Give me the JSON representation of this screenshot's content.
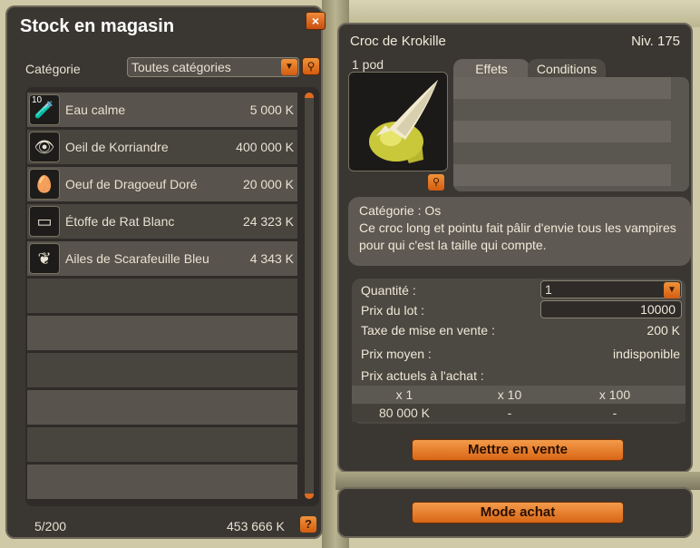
{
  "stock_panel": {
    "title": "Stock en magasin",
    "close": "×",
    "category_label": "Catégorie",
    "category_value": "Toutes catégories",
    "items": [
      {
        "name": "Eau calme",
        "price": "5 000 K",
        "qty": "10",
        "icon": "potion-icon",
        "glyph": "🧪"
      },
      {
        "name": "Oeil de Korriandre",
        "price": "400 000 K",
        "qty": "",
        "icon": "eye-icon",
        "glyph": "👁"
      },
      {
        "name": "Oeuf de Dragoeuf Doré",
        "price": "20 000 K",
        "qty": "",
        "icon": "egg-icon",
        "glyph": "🥚"
      },
      {
        "name": "Étoffe de Rat Blanc",
        "price": "24 323 K",
        "qty": "",
        "icon": "cloth-icon",
        "glyph": "▭"
      },
      {
        "name": "Ailes de Scarafeuille Bleu",
        "price": "4 343 K",
        "qty": "",
        "icon": "wing-icon",
        "glyph": "❦"
      }
    ],
    "count": "5/200",
    "total": "453 666 K",
    "help": "?"
  },
  "item_panel": {
    "name": "Croc de Krokille",
    "level": "Niv. 175",
    "pods": "1 pod",
    "tabs": [
      "Effets",
      "Conditions"
    ],
    "description_category": "Catégorie : Os",
    "description": "Ce croc long et pointu fait pâlir d'envie tous les vampires pour qui c'est la taille qui compte.",
    "sell": {
      "quantity_label": "Quantité :",
      "quantity_value": "1",
      "lot_price_label": "Prix du lot :",
      "lot_price_value": "10000",
      "tax_label": "Taxe de mise en vente :",
      "tax_value": "200 K",
      "avg_price_label": "Prix moyen :",
      "avg_price_value": "indisponible",
      "current_prices_label": "Prix actuels à l'achat :",
      "price_headers": [
        "x 1",
        "x 10",
        "x 100"
      ],
      "price_values": [
        "80 000 K",
        "-",
        "-"
      ]
    },
    "sell_button": "Mettre en vente"
  },
  "buy_button": "Mode achat",
  "colors": {
    "accent": "#e06a1e",
    "panel": "#3a3632"
  }
}
